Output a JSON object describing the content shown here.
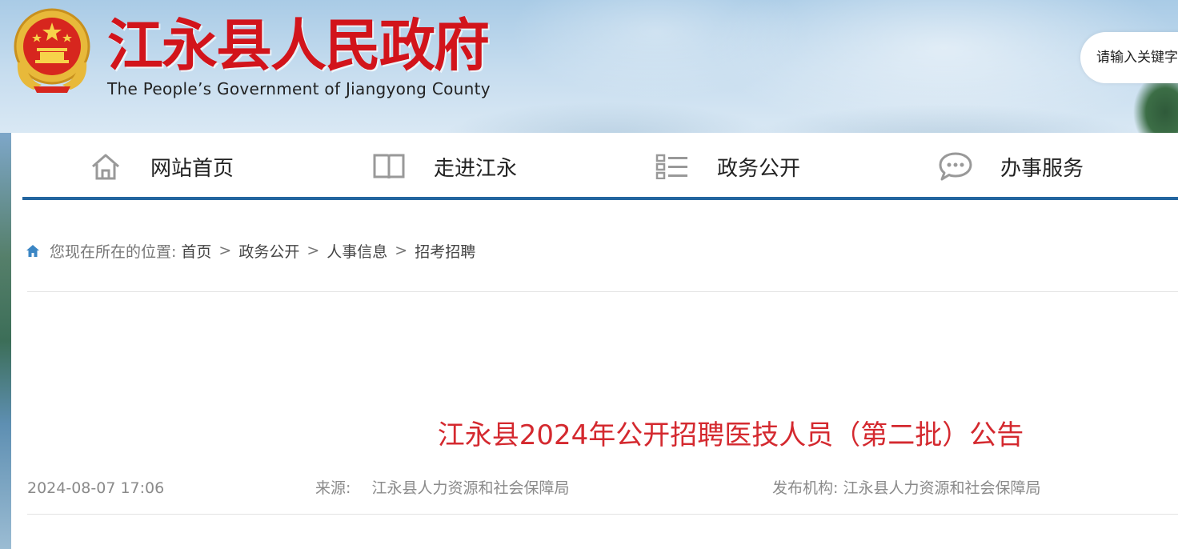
{
  "header": {
    "site_title": "江永县人民政府",
    "site_subtitle": "The People’s Government of Jiangyong County",
    "emblem_icon": "national-emblem-icon",
    "search_placeholder": "请输入关键字"
  },
  "nav": {
    "items": [
      {
        "label": "网站首页",
        "icon": "home-icon"
      },
      {
        "label": "走进江永",
        "icon": "book-icon"
      },
      {
        "label": "政务公开",
        "icon": "list-icon"
      },
      {
        "label": "办事服务",
        "icon": "chat-icon"
      }
    ],
    "accent_color": "#23659f"
  },
  "breadcrumb": {
    "prefix": "您现在所在的位置:",
    "items": [
      "首页",
      "政务公开",
      "人事信息",
      "招考招聘"
    ],
    "separator": ">"
  },
  "article": {
    "title": "江永县2024年公开招聘医技人员（第二批）公告",
    "date": "2024-08-07 17:06",
    "source_label": "来源:",
    "source_value": "江永县人力资源和社会保障局",
    "publisher_label": "发布机构:",
    "publisher_value": "江永县人力资源和社会保障局",
    "title_color": "#d4292f"
  }
}
